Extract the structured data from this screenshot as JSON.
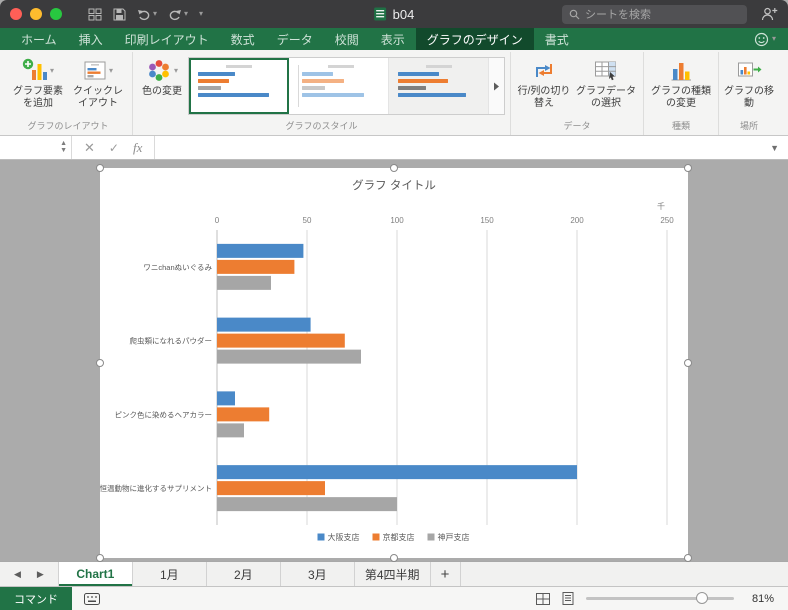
{
  "titlebar": {
    "title": "b04",
    "search_placeholder": "シートを検索"
  },
  "tabs": {
    "items": [
      {
        "label": "ホーム",
        "active": false
      },
      {
        "label": "挿入",
        "active": false
      },
      {
        "label": "印刷レイアウト",
        "active": false
      },
      {
        "label": "数式",
        "active": false
      },
      {
        "label": "データ",
        "active": false
      },
      {
        "label": "校閲",
        "active": false
      },
      {
        "label": "表示",
        "active": false
      },
      {
        "label": "グラフのデザイン",
        "active": true
      },
      {
        "label": "書式",
        "active": false
      }
    ]
  },
  "ribbon": {
    "add_chart_element": "グラフ要素を追加",
    "quick_layout": "クイックレイアウト",
    "chart_layout_group": "グラフのレイアウト",
    "change_colors": "色の変更",
    "chart_styles_group": "グラフのスタイル",
    "switch_row_column": "行/列の切り替え",
    "select_data": "グラフデータの選択",
    "data_group": "データ",
    "change_chart_type": "グラフの種類の変更",
    "type_group": "種類",
    "move_chart": "グラフの移動",
    "location_group": "場所"
  },
  "formula_bar": {
    "fx": "fx"
  },
  "chart_data": {
    "type": "bar",
    "orientation": "horizontal",
    "title": "グラフ タイトル",
    "unit_label": "千",
    "categories": [
      "ワニchanぬいぐるみ",
      "爬虫類になれるパウダー",
      "ピンク色に染めるヘアカラー",
      "恒温動物に進化するサプリメント"
    ],
    "series": [
      {
        "name": "大阪支店",
        "color": "#4a89c8",
        "values": [
          48,
          52,
          10,
          200
        ]
      },
      {
        "name": "京都支店",
        "color": "#ed7d31",
        "values": [
          43,
          71,
          29,
          60
        ]
      },
      {
        "name": "神戸支店",
        "color": "#a6a6a6",
        "values": [
          30,
          80,
          15,
          100
        ]
      }
    ],
    "x_ticks": [
      0,
      50,
      100,
      150,
      200,
      250
    ],
    "xlim": [
      0,
      250
    ],
    "value_axis_position": "top",
    "legend_position": "bottom",
    "grid": true
  },
  "sheet_tabs": {
    "items": [
      {
        "label": "Chart1",
        "active": true
      },
      {
        "label": "1月",
        "active": false
      },
      {
        "label": "2月",
        "active": false
      },
      {
        "label": "3月",
        "active": false
      },
      {
        "label": "第4四半期",
        "active": false
      }
    ],
    "add": "+"
  },
  "status_bar": {
    "mode": "コマンド",
    "zoom": "81%"
  },
  "theme": {
    "green": "#217346",
    "active_tab_green": "#124a2c"
  }
}
